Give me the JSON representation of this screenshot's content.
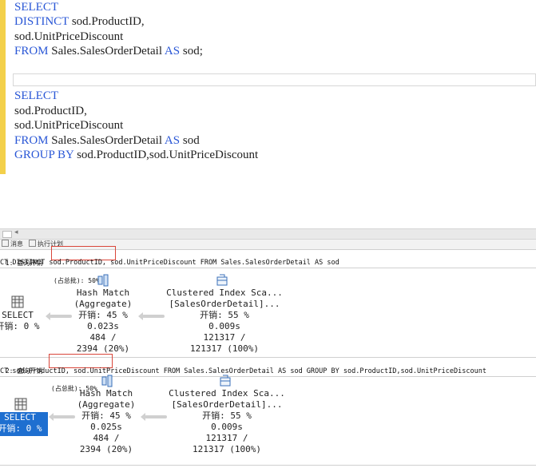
{
  "editor": {
    "lines": [
      [
        {
          "t": "SELECT",
          "k": "kw"
        }
      ],
      [
        {
          "t": "DISTINCT",
          "k": "kw"
        },
        {
          "t": " sod.ProductID,",
          "k": "tb"
        }
      ],
      [
        {
          "t": "sod.UnitPriceDiscount",
          "k": "tb"
        }
      ],
      [
        {
          "t": "FROM",
          "k": "kw"
        },
        {
          "t": " Sales.SalesOrderDetail ",
          "k": "tb"
        },
        {
          "t": "AS",
          "k": "kw"
        },
        {
          "t": " sod;",
          "k": "tb"
        }
      ],
      [],
      [],
      [
        {
          "t": "SELECT",
          "k": "kw"
        }
      ],
      [
        {
          "t": "sod.ProductID,",
          "k": "tb"
        }
      ],
      [
        {
          "t": "sod.UnitPriceDiscount",
          "k": "tb"
        }
      ],
      [
        {
          "t": "FROM",
          "k": "kw"
        },
        {
          "t": " Sales.SalesOrderDetail ",
          "k": "tb"
        },
        {
          "t": "AS",
          "k": "kw"
        },
        {
          "t": " sod",
          "k": "tb"
        }
      ],
      [
        {
          "t": "GROUP BY",
          "k": "kw"
        },
        {
          "t": " sod.ProductID,sod.UnitPriceDiscount",
          "k": "tb"
        }
      ]
    ]
  },
  "tabs": {
    "messages": "消息",
    "plan": "执行计划"
  },
  "queries": [
    {
      "header_prefix": " 1: 查询开销",
      "header_boxed": "(占总批): 50%",
      "sql": "CT DISTINCT sod.ProductID, sod.UnitPriceDiscount FROM Sales.SalesOrderDetail AS sod",
      "select": {
        "label": "SELECT",
        "cost": "开销: 0 %"
      },
      "hash": {
        "name": "Hash Match",
        "sub": "(Aggregate)",
        "cost": "开销: 45 %",
        "time": "0.023s",
        "rows": "484 /",
        "est": "2394 (20%)"
      },
      "scan": {
        "name": "Clustered Index Sca...",
        "sub": "[SalesOrderDetail]...",
        "cost": "开销: 55 %",
        "time": "0.009s",
        "rows": "121317 /",
        "est": "121317 (100%)"
      }
    },
    {
      "header_prefix": " 2: 查询开销",
      "header_boxed": "(占总批): 50%",
      "sql": "CT sod.ProductID, sod.UnitPriceDiscount FROM Sales.SalesOrderDetail AS sod GROUP BY sod.ProductID,sod.UnitPriceDiscount",
      "select": {
        "label": "SELECT",
        "cost": "开销: 0 %"
      },
      "hash": {
        "name": "Hash Match",
        "sub": "(Aggregate)",
        "cost": "开销: 45 %",
        "time": "0.025s",
        "rows": "484 /",
        "est": "2394 (20%)"
      },
      "scan": {
        "name": "Clustered Index Sca...",
        "sub": "[SalesOrderDetail]...",
        "cost": "开销: 55 %",
        "time": "0.009s",
        "rows": "121317 /",
        "est": "121317 (100%)"
      }
    }
  ]
}
